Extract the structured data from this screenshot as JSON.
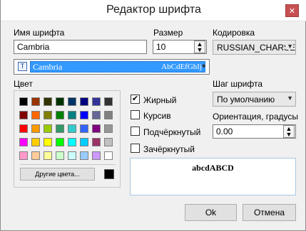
{
  "window": {
    "title": "Редактор шрифта",
    "close_glyph": "✕"
  },
  "font_name": {
    "label": "Имя шрифта",
    "value": "Cambria"
  },
  "size": {
    "label": "Размер",
    "value": "10"
  },
  "encoding": {
    "label": "Кодировка",
    "value": "RUSSIAN_CHARSET"
  },
  "font_list": {
    "selected": "Cambria",
    "sample": "AbCdEfGhIj",
    "icon_glyph": "T"
  },
  "color": {
    "label": "Цвет",
    "palette": [
      [
        "#000000",
        "#993300",
        "#333300",
        "#003300",
        "#003366",
        "#000080",
        "#333399",
        "#333333"
      ],
      [
        "#800000",
        "#ff6600",
        "#808000",
        "#008000",
        "#008080",
        "#0000ff",
        "#666699",
        "#808080"
      ],
      [
        "#ff0000",
        "#ff9900",
        "#99cc00",
        "#339966",
        "#33cccc",
        "#3366ff",
        "#800080",
        "#969696"
      ],
      [
        "#ff00ff",
        "#ffcc00",
        "#ffff00",
        "#00ff00",
        "#00ffff",
        "#00ccff",
        "#993366",
        "#c0c0c0"
      ],
      [
        "#ff99cc",
        "#ffcc99",
        "#ffff99",
        "#ccffcc",
        "#ccffff",
        "#99ccff",
        "#cc99ff",
        "#ffffff"
      ]
    ],
    "other_colors_button": "Другие цвета...",
    "current_color": "#000000"
  },
  "styles": {
    "bold": {
      "label": "Жирный",
      "checked": true
    },
    "italic": {
      "label": "Курсив",
      "checked": false
    },
    "underline": {
      "label": "Подчёркнутый",
      "checked": false
    },
    "strikeout": {
      "label": "Зачёркнутый",
      "checked": false
    }
  },
  "step": {
    "label": "Шаг шрифта",
    "value": "По умолчанию"
  },
  "orientation": {
    "label": "Ориентация, градусы",
    "value": "0.00"
  },
  "preview": {
    "text": "abcdABCD"
  },
  "buttons": {
    "ok": "Ok",
    "cancel": "Отмена"
  }
}
